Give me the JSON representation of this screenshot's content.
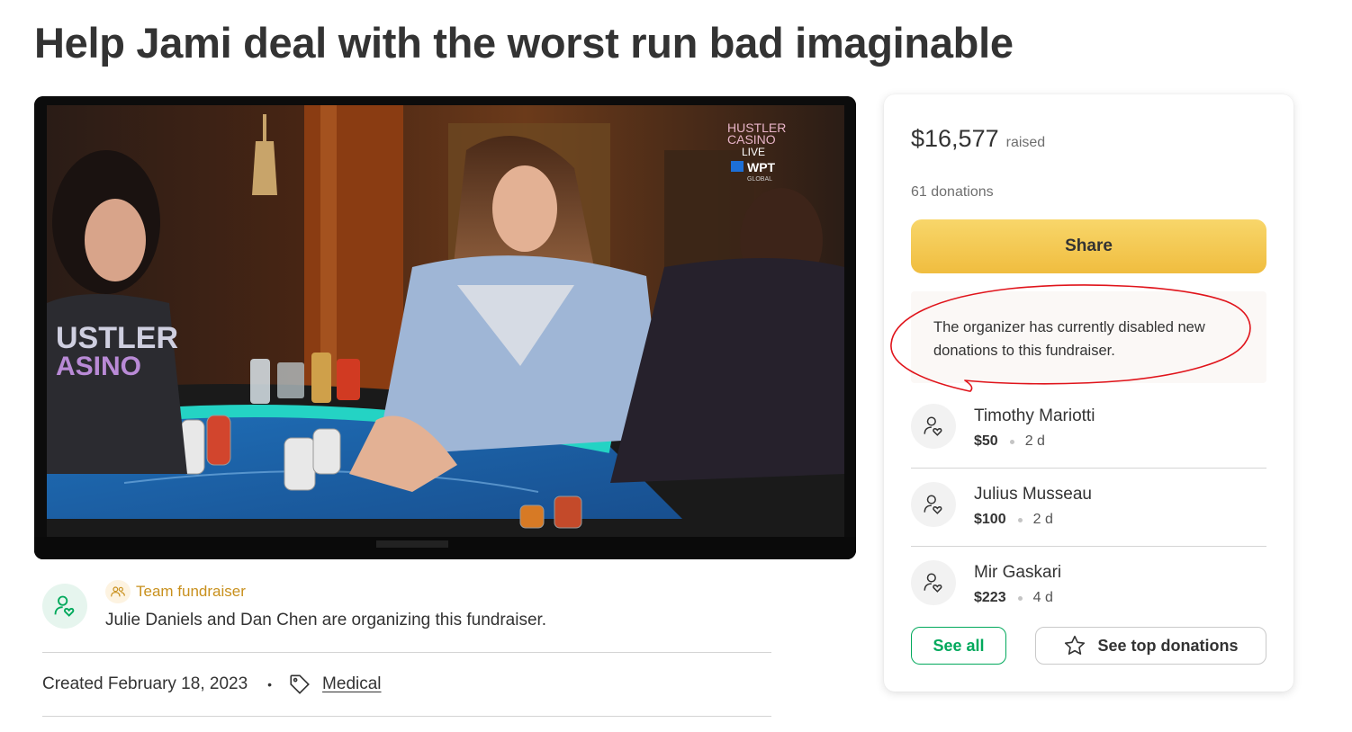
{
  "page": {
    "title": "Help Jami deal with the worst run bad imaginable"
  },
  "hero": {
    "description": "Poker table on TV screen",
    "overlay_logo": {
      "line1": "HUSTLER",
      "line2": "CASINO",
      "line3": "LIVE",
      "wpt": "WPT",
      "wpt_sub": "GLOBAL"
    },
    "shirt_text": {
      "line1": "USTLER",
      "line2": "ASINO"
    }
  },
  "organizer": {
    "badge_label": "Team fundraiser",
    "text": "Julie Daniels and Dan Chen are organizing this fundraiser.",
    "created": "Created February 18, 2023",
    "bullet": "•",
    "category": "Medical"
  },
  "donation_card": {
    "raised_amount": "$16,577",
    "raised_label": "raised",
    "donation_count": "61 donations",
    "share_label": "Share",
    "notice": "The organizer has currently disabled new donations to this fundraiser.",
    "donors": [
      {
        "name": "Timothy Mariotti",
        "amount": "$50",
        "time": "2 d"
      },
      {
        "name": "Julius Musseau",
        "amount": "$100",
        "time": "2 d"
      },
      {
        "name": "Mir Gaskari",
        "amount": "$223",
        "time": "4 d"
      }
    ],
    "see_all_label": "See all",
    "see_top_label": "See top donations"
  },
  "colors": {
    "accent_green": "#02a95c",
    "share_yellow": "#f0bd3f",
    "annotation_red": "#e0141b",
    "badge_gold": "#c8901d"
  },
  "icons": [
    "user-heart-icon",
    "team-icon",
    "tag-icon",
    "star-icon"
  ]
}
